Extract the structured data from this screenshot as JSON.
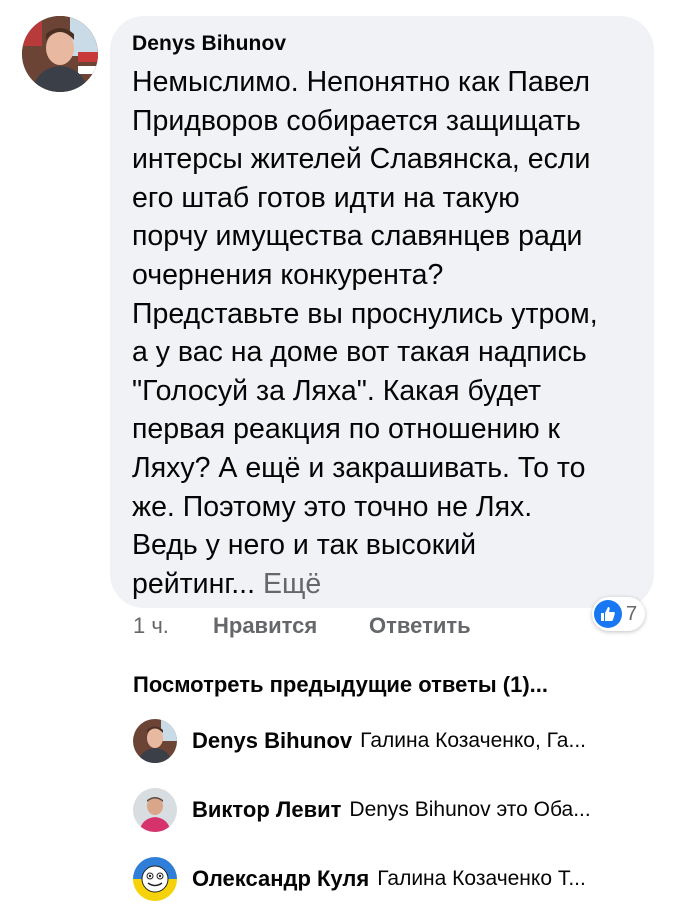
{
  "comment": {
    "author": "Denys Bihunov",
    "text": "Немыслимо. Непонятно как Павел\nПридворов собирается защищать\nинтерсы жителей Славянска, если\nего штаб готов идти на такую\nпорчу имущества славянцев ради\nочернения конкурента?\nПредставьте вы проснулись утром,\nа у вас на доме вот такая надпись\n\"Голосуй за Ляха\". Какая будет\nпервая реакция по отношению к\nЛяху? А ещё и закрашивать. То то\nже. Поэтому это точно не Лях.\nВедь у него и так высокий\nрейтинг...",
    "more_label": "Ещё",
    "time": "1 ч.",
    "like_label": "Нравится",
    "reply_label": "Ответить",
    "reaction_count": "7",
    "reaction_icon": "like-icon",
    "accent_color": "#1877f2"
  },
  "previous_replies_label": "Посмотреть предыдущие ответы (1)...",
  "replies": [
    {
      "author": "Denys Bihunov",
      "snippet": "Галина Козаченко, Га..."
    },
    {
      "author": "Виктор Левит",
      "snippet": "Denys Bihunov это Оба..."
    },
    {
      "author": "Олександр Куля",
      "snippet": "Галина Козаченко Т..."
    }
  ]
}
